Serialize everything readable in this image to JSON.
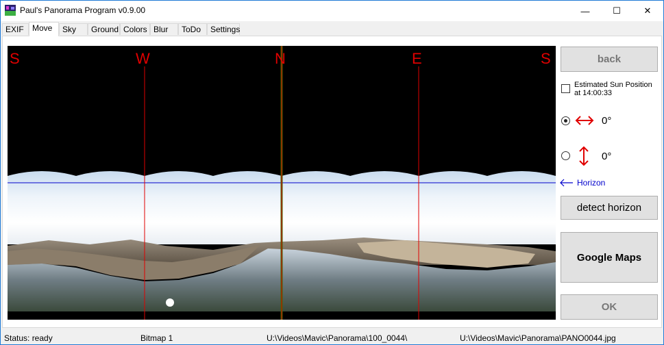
{
  "window": {
    "title": "Paul's Panorama Program v0.9.00",
    "minimize": "—",
    "maximize": "☐",
    "close": "✕"
  },
  "tabs": [
    "EXIF",
    "Move",
    "Sky",
    "Ground",
    "Colors",
    "Blur",
    "ToDo",
    "Settings"
  ],
  "active_tab": "Move",
  "compass": {
    "s_left": "S",
    "w": "W",
    "n": "N",
    "e": "E",
    "s_right": "S"
  },
  "controls": {
    "back_label": "back",
    "sun_label_line1": "Estimated Sun Position",
    "sun_label_line2": "at 14:00:33",
    "horizontal_angle": "0°",
    "vertical_angle": "0°",
    "horizon_label": "Horizon",
    "detect_label": "detect horizon",
    "maps_label": "Google Maps",
    "ok_label": "OK"
  },
  "status": {
    "state": "Status: ready",
    "bitmap": "Bitmap 1",
    "folder": "U:\\Videos\\Mavic\\Panorama\\100_0044\\",
    "file": "U:\\Videos\\Mavic\\Panorama\\PANO0044.jpg"
  },
  "colors": {
    "accent": "#1e7ad6",
    "compass_red": "#e00000",
    "horizon_blue": "#0000cc",
    "north_line": "#3a6e00"
  }
}
